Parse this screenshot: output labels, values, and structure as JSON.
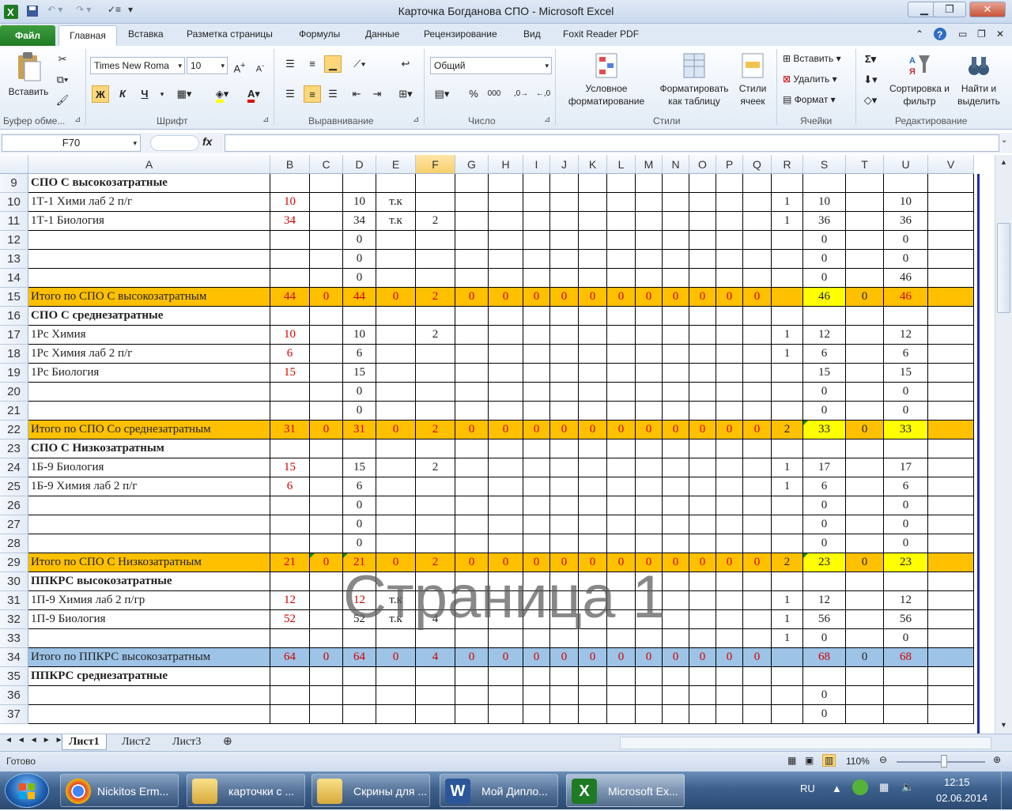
{
  "window": {
    "title": "Карточка Богданова СПО  -  Microsoft Excel"
  },
  "colors": {
    "orange_row": "#ffc000",
    "blue_row": "#9dc3e6",
    "yellow_cell": "#ffff00",
    "red_text": "#d00000",
    "file_tab": "#2a8a2f"
  },
  "ribbon": {
    "tabs": [
      "Файл",
      "Главная",
      "Вставка",
      "Разметка страницы",
      "Формулы",
      "Данные",
      "Рецензирование",
      "Вид",
      "Foxit Reader PDF"
    ],
    "clipboard": {
      "paste": "Вставить",
      "label": "Буфер обме..."
    },
    "font": {
      "name": "Times New Roma",
      "size": "10",
      "bold": "Ж",
      "italic": "К",
      "underline": "Ч",
      "label": "Шрифт"
    },
    "alignment": {
      "label": "Выравнивание"
    },
    "number": {
      "format": "Общий",
      "label": "Число"
    },
    "styles": {
      "conditional": "Условное форматирование",
      "as_table": "Форматировать как таблицу",
      "cell_styles": "Стили ячеек",
      "label": "Стили"
    },
    "cells": {
      "insert": "Вставить",
      "delete": "Удалить",
      "format": "Формат",
      "label": "Ячейки"
    },
    "editing": {
      "sort": "Сортировка и фильтр",
      "find": "Найти и выделить",
      "label": "Редактирование"
    }
  },
  "formula_bar": {
    "name_box": "F70",
    "fx": "fx",
    "formula": ""
  },
  "columns": [
    "A",
    "B",
    "C",
    "D",
    "E",
    "F",
    "G",
    "H",
    "I",
    "J",
    "K",
    "L",
    "M",
    "N",
    "O",
    "P",
    "Q",
    "R",
    "S",
    "T",
    "U",
    "V"
  ],
  "selected_column": "F",
  "rows": [
    {
      "n": "9",
      "type": "header",
      "A": "СПО С высокозатратные"
    },
    {
      "n": "10",
      "A": "1Т-1 Хими лаб 2 п/г",
      "B": "10",
      "D": "10",
      "E": "т.к",
      "R": "1",
      "S": "10",
      "U": "10"
    },
    {
      "n": "11",
      "A": "1Т-1 Биология",
      "B": "34",
      "D": "34",
      "E": "т.к",
      "F": "2",
      "R": "1",
      "S": "36",
      "U": "36"
    },
    {
      "n": "12",
      "D": "0",
      "S": "0",
      "U": "0"
    },
    {
      "n": "13",
      "D": "0",
      "S": "0",
      "U": "0"
    },
    {
      "n": "14",
      "D": "0",
      "S": "0",
      "U": "46"
    },
    {
      "n": "15",
      "type": "orange",
      "A": "Итого по СПО С высокозатратным",
      "B": "44",
      "C": "0",
      "D": "44",
      "E": "0",
      "F": "2",
      "G": "0",
      "H": "0",
      "I": "0",
      "J": "0",
      "K": "0",
      "L": "0",
      "M": "0",
      "N": "0",
      "O": "0",
      "P": "0",
      "Q": "0",
      "R": "",
      "S": "46",
      "T": "0",
      "U": "46",
      "yellowS": true
    },
    {
      "n": "16",
      "type": "header",
      "A": "СПО С среднезатратные"
    },
    {
      "n": "17",
      "A": "1Рс Химия",
      "B": "10",
      "D": "10",
      "F": "2",
      "R": "1",
      "S": "12",
      "U": "12"
    },
    {
      "n": "18",
      "A": "1Рс Химия лаб 2 п/г",
      "B": "6",
      "D": "6",
      "R": "1",
      "S": "6",
      "U": "6"
    },
    {
      "n": "19",
      "A": "1Рс Биология",
      "B": "15",
      "D": "15",
      "S": "15",
      "U": "15"
    },
    {
      "n": "20",
      "D": "0",
      "S": "0",
      "U": "0"
    },
    {
      "n": "21",
      "D": "0",
      "S": "0",
      "U": "0"
    },
    {
      "n": "22",
      "type": "orange",
      "A": "Итого по СПО Со среднезатратным",
      "B": "31",
      "C": "0",
      "D": "31",
      "E": "0",
      "F": "2",
      "G": "0",
      "H": "0",
      "I": "0",
      "J": "0",
      "K": "0",
      "L": "0",
      "M": "0",
      "N": "0",
      "O": "0",
      "P": "0",
      "Q": "0",
      "R": "2",
      "S": "33",
      "T": "0",
      "U": "33",
      "yellowS": true,
      "yellowU": true
    },
    {
      "n": "23",
      "type": "header",
      "A": "СПО С Низкозатратным"
    },
    {
      "n": "24",
      "A": "1Б-9 Биология",
      "B": "15",
      "D": "15",
      "F": "2",
      "R": "1",
      "S": "17",
      "U": "17"
    },
    {
      "n": "25",
      "A": "1Б-9 Химия лаб 2 п/г",
      "B": "6",
      "D": "6",
      "R": "1",
      "S": "6",
      "U": "6"
    },
    {
      "n": "26",
      "D": "0",
      "S": "0",
      "U": "0"
    },
    {
      "n": "27",
      "D": "0",
      "S": "0",
      "U": "0"
    },
    {
      "n": "28",
      "D": "0",
      "S": "0",
      "U": "0"
    },
    {
      "n": "29",
      "type": "orange",
      "A": "Итого по СПО С Низкозатратным",
      "B": "21",
      "C": "0",
      "D": "21",
      "E": "0",
      "F": "2",
      "G": "0",
      "H": "0",
      "I": "0",
      "J": "0",
      "K": "0",
      "L": "0",
      "M": "0",
      "N": "0",
      "O": "0",
      "P": "0",
      "Q": "0",
      "R": "2",
      "S": "23",
      "T": "0",
      "U": "23",
      "yellowS": true,
      "yellowU": true
    },
    {
      "n": "30",
      "type": "header",
      "A": "ППКРС  высокозатратные"
    },
    {
      "n": "31",
      "A": "1П-9 Химия лаб 2 п/гр",
      "B": "12",
      "D": "12",
      "E": "т.к",
      "R": "1",
      "S": "12",
      "U": "12"
    },
    {
      "n": "32",
      "A": "1П-9 Биология",
      "B": "52",
      "D": "52",
      "E": "т.к",
      "F": "4",
      "R": "1",
      "S": "56",
      "U": "56"
    },
    {
      "n": "33",
      "R": "1",
      "S": "0",
      "U": "0"
    },
    {
      "n": "34",
      "type": "blue",
      "A": "Итого по ППКРС высокозатратным",
      "B": "64",
      "C": "0",
      "D": "64",
      "E": "0",
      "F": "4",
      "G": "0",
      "H": "0",
      "I": "0",
      "J": "0",
      "K": "0",
      "L": "0",
      "M": "0",
      "N": "0",
      "O": "0",
      "P": "0",
      "Q": "0",
      "R": "",
      "S": "68",
      "T": "0",
      "U": "68"
    },
    {
      "n": "35",
      "type": "header",
      "A": "ППКРС среднезатратные"
    },
    {
      "n": "36",
      "S": "0"
    },
    {
      "n": "37",
      "S": "0"
    }
  ],
  "watermark": "Страница 1",
  "sheets": [
    "Лист1",
    "Лист2",
    "Лист3"
  ],
  "status": {
    "ready": "Готово",
    "zoom": "110%"
  },
  "taskbar": {
    "items": [
      "Nickitos Erm...",
      "карточки с ...",
      "Скрины для ...",
      "Мой Диплo...",
      "Microsoft Ex..."
    ],
    "lang": "RU",
    "time": "12:15",
    "date": "02.06.2014"
  }
}
